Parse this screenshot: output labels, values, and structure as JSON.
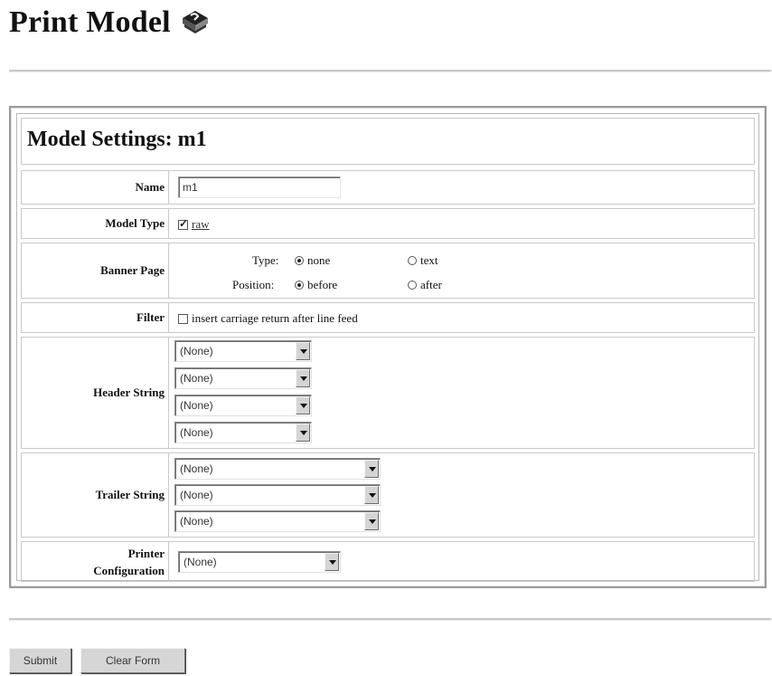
{
  "page": {
    "title": "Print Model"
  },
  "settings": {
    "heading": "Model Settings: m1",
    "name": {
      "label": "Name",
      "value": "m1"
    },
    "model_type": {
      "label": "Model Type",
      "option": "raw",
      "checked": true
    },
    "banner_page": {
      "label": "Banner Page",
      "type_label": "Type:",
      "type_options": [
        "none",
        "text"
      ],
      "type_selected": "none",
      "position_label": "Position:",
      "position_options": [
        "before",
        "after"
      ],
      "position_selected": "before"
    },
    "filter": {
      "label": "Filter",
      "option": "insert carriage return after line feed",
      "checked": false
    },
    "header_string": {
      "label": "Header String",
      "values": [
        "(None)",
        "(None)",
        "(None)",
        "(None)"
      ]
    },
    "trailer_string": {
      "label": "Trailer String",
      "values": [
        "(None)",
        "(None)",
        "(None)"
      ]
    },
    "printer_configuration": {
      "label_line1": "Printer",
      "label_line2": "Configuration",
      "value": "(None)"
    }
  },
  "buttons": {
    "submit": "Submit",
    "clear": "Clear Form"
  },
  "icons": {
    "title_icon": "book-icon"
  },
  "colors": {
    "border": "#9a9a9a",
    "button_face": "#d6d6d6"
  }
}
